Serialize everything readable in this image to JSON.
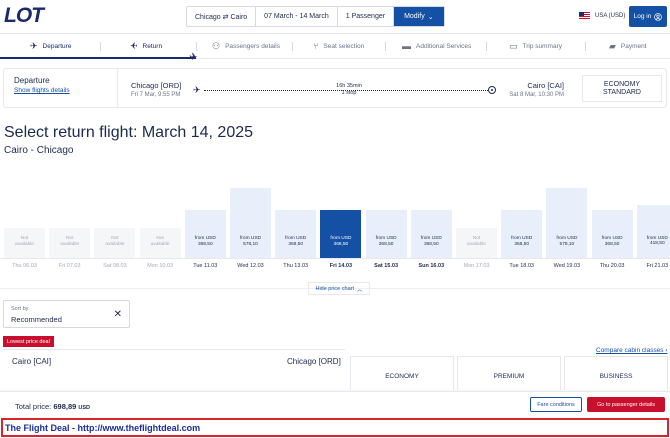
{
  "header": {
    "logo": "LOT",
    "search": {
      "route": "Chicago ⇄ Cairo",
      "dates": "07 March - 14 March",
      "passengers": "1 Passenger",
      "modify": "Modify"
    },
    "currency": "USA (USD)",
    "login": "Log in"
  },
  "steps": [
    {
      "label": "Departure",
      "icon": "plane-takeoff-icon",
      "state": "done"
    },
    {
      "label": "Return",
      "icon": "plane-landing-icon",
      "state": "active"
    },
    {
      "label": "Passengers details",
      "icon": "passengers-icon",
      "state": "upcoming"
    },
    {
      "label": "Seat selection",
      "icon": "seat-icon",
      "state": "upcoming"
    },
    {
      "label": "Additional Services",
      "icon": "briefcase-icon",
      "state": "upcoming"
    },
    {
      "label": "Trip summary",
      "icon": "summary-icon",
      "state": "upcoming"
    },
    {
      "label": "Payment",
      "icon": "wallet-icon",
      "state": "upcoming"
    }
  ],
  "summary": {
    "title": "Departure",
    "details_link": "Show flights details",
    "origin": "Chicago [ORD]",
    "origin_date": "Fri 7 Mar, 9:55 PM",
    "duration": "16h 35min",
    "stops": "1 stop",
    "destination": "Cairo [CAI]",
    "destination_date": "Sat 8 Mar, 10:30 PM",
    "cabin_line1": "ECONOMY",
    "cabin_line2": "STANDARD"
  },
  "main": {
    "title": "Select return flight: March 14, 2025",
    "subtitle": "Cairo - Chicago"
  },
  "chart_data": {
    "type": "bar",
    "categories": [
      "Thu 06.03",
      "Fri 07.03",
      "Sat 08.03",
      "Mon 10.03",
      "Tue 11.03",
      "Wed 12.03",
      "Thu 13.03",
      "Fri 14.03",
      "Sat 15.03",
      "Sun 16.03",
      "Mon 17.03",
      "Tue 18.03",
      "Wed 19.03",
      "Thu 20.03",
      "Fri 21.03"
    ],
    "labels": [
      "Not available",
      "Not available",
      "Not available",
      "Not available",
      "from USD 368,50",
      "from USD 578,10",
      "from USD 368,50",
      "from USD 368,50",
      "from USD 368,50",
      "from USD 368,50",
      "Not available",
      "from USD 368,50",
      "from USD 578,10",
      "from USD 368,50",
      "from USD 418,50"
    ],
    "values": [
      null,
      null,
      null,
      null,
      368.5,
      578.1,
      368.5,
      368.5,
      368.5,
      368.5,
      null,
      368.5,
      578.1,
      368.5,
      418.5
    ],
    "selected": "Fri 14.03",
    "currency": "USD"
  },
  "chart_controls": {
    "hide_chart": "Hide price chart"
  },
  "sort": {
    "label": "Sort by",
    "value": "Recommended"
  },
  "results": {
    "badge": "Lowest price deal",
    "compare_link": "Compare cabin classes",
    "origin": "Cairo [CAI]",
    "destination": "Chicago [ORD]",
    "cabins": [
      "ECONOMY",
      "PREMIUM",
      "BUSINESS"
    ]
  },
  "footer": {
    "total_label": "Total price:",
    "total_value": "698,89",
    "total_currency": "USD",
    "fare_conditions": "Fare conditions",
    "go_button": "Go to passenger details"
  },
  "banner": {
    "text": "The Flight Deal - http://www.theflightdeal.com"
  },
  "colors": {
    "navy": "#1b2a6b",
    "accent_blue": "#1450a3",
    "bar_light": "#e8eefa",
    "red": "#c8102e"
  }
}
